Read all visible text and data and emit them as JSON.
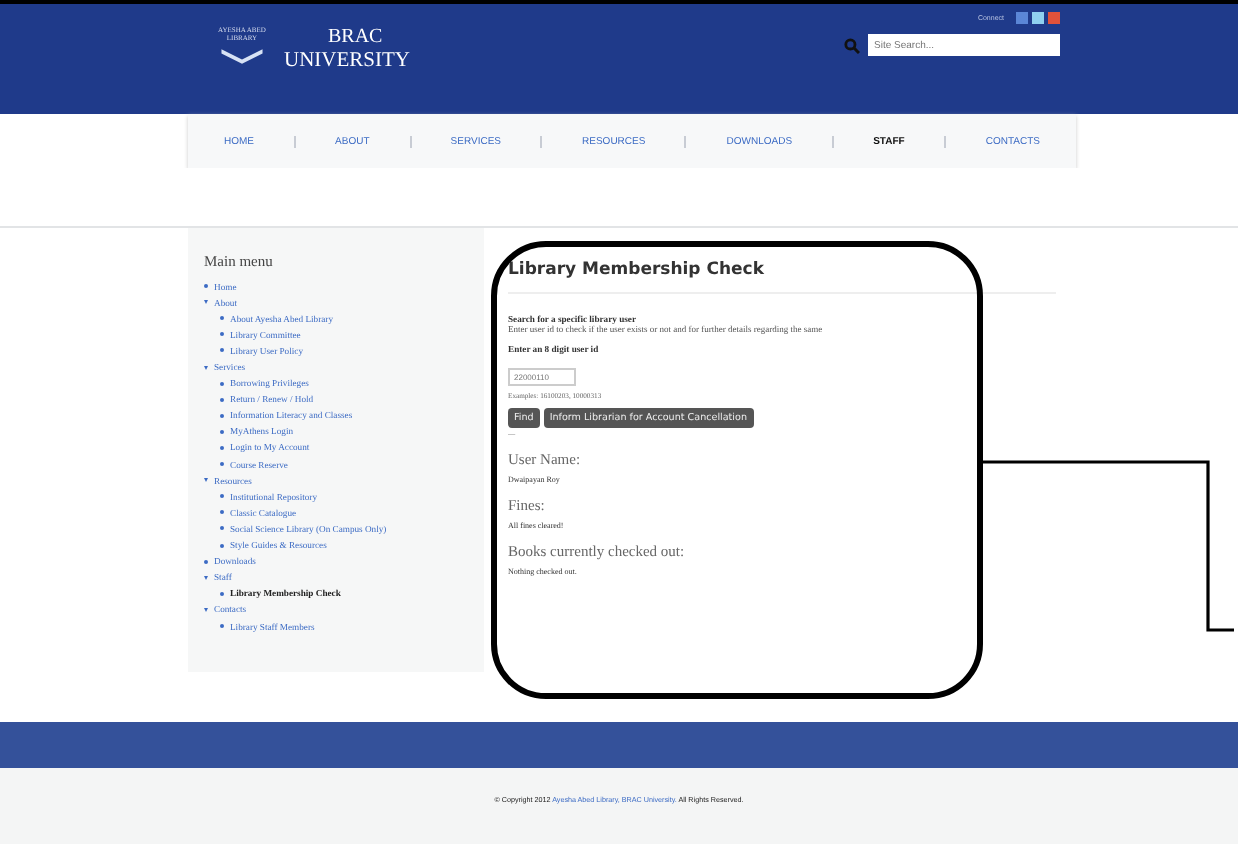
{
  "header": {
    "logo": {
      "library": "AYESHA ABED LIBRARY",
      "name_line1": "BRAC",
      "name_line2": "UNIVERSITY"
    },
    "connect": "Connect",
    "search": {
      "placeholder": "Site Search..."
    }
  },
  "nav": [
    {
      "label": "HOME",
      "selected": false
    },
    {
      "label": "ABOUT",
      "selected": false
    },
    {
      "label": "SERVICES",
      "selected": false
    },
    {
      "label": "RESOURCES",
      "selected": false
    },
    {
      "label": "DOWNLOADS",
      "selected": false
    },
    {
      "label": "STAFF",
      "selected": true
    },
    {
      "label": "CONTACTS",
      "selected": false
    }
  ],
  "sidebar": {
    "title": "Main menu",
    "items": [
      {
        "label": "Home",
        "selected": false
      },
      {
        "label": "About",
        "selected": false,
        "children": [
          {
            "label": "About Ayesha Abed Library",
            "selected": false
          },
          {
            "label": "Library Committee",
            "selected": false
          },
          {
            "label": "Library User Policy",
            "selected": false
          }
        ]
      },
      {
        "label": "Services",
        "selected": false,
        "children": [
          {
            "label": "Borrowing Privileges",
            "selected": false
          },
          {
            "label": "Return / Renew / Hold",
            "selected": false
          },
          {
            "label": "Information Literacy and Classes",
            "selected": false
          },
          {
            "label": "MyAthens Login",
            "selected": false
          },
          {
            "label": "Login to My Account",
            "selected": false
          },
          {
            "label": "Course Reserve",
            "selected": false
          }
        ]
      },
      {
        "label": "Resources",
        "selected": false,
        "children": [
          {
            "label": "Institutional Repository",
            "selected": false
          },
          {
            "label": "Classic Catalogue",
            "selected": false
          },
          {
            "label": "Social Science Library (On Campus Only)",
            "selected": false
          },
          {
            "label": "Style Guides & Resources",
            "selected": false
          }
        ]
      },
      {
        "label": "Downloads",
        "selected": false
      },
      {
        "label": "Staff",
        "selected": false,
        "children": [
          {
            "label": "Library Membership Check",
            "selected": true
          }
        ]
      },
      {
        "label": "Contacts",
        "selected": false,
        "children": [
          {
            "label": "Library Staff Members",
            "selected": false
          }
        ]
      }
    ]
  },
  "main": {
    "title": "Library Membership Check",
    "search_heading": "Search for a specific library user",
    "search_help": "Enter user id to check if the user exists or not and for further details regarding the same",
    "id_label": "Enter an 8 digit user id",
    "id_field": {
      "placeholder": "22000110"
    },
    "examples": "Examples: 16100203, 10000313",
    "buttons": [
      "Find",
      "Inform Librarian for Account Cancellation"
    ],
    "divider_mark": "—",
    "results": [
      {
        "heading": "User Name:",
        "value": "Dwaipayan Roy"
      },
      {
        "heading": "Fines:",
        "value": "All fines cleared!"
      },
      {
        "heading": "Books currently checked out:",
        "value": "Nothing checked out."
      }
    ]
  },
  "footer": {
    "copyright_before": "© Copyright 2012",
    "link": "Ayesha Abed Library, BRAC University.",
    "copyright_after": "All Rights Reserved."
  }
}
